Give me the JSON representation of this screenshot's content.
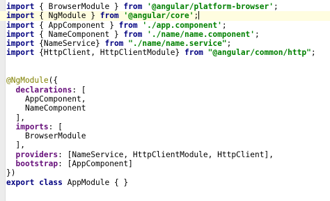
{
  "colors": {
    "keyword": "#000080",
    "string": "#008000",
    "property": "#660e7a",
    "annotation": "#808000",
    "current_line": "#fffde0"
  },
  "lines": [
    {
      "tokens": [
        {
          "t": "import",
          "k": "kw"
        },
        {
          "t": " { BrowserModule } ",
          "k": "plain"
        },
        {
          "t": "from",
          "k": "kw"
        },
        {
          "t": " ",
          "k": "plain"
        },
        {
          "t": "'@angular/platform-browser'",
          "k": "str"
        },
        {
          "t": ";",
          "k": "plain"
        }
      ]
    },
    {
      "current": true,
      "tokens": [
        {
          "t": "import",
          "k": "kw"
        },
        {
          "t": " { NgModule } ",
          "k": "plain"
        },
        {
          "t": "from",
          "k": "kw"
        },
        {
          "t": " ",
          "k": "plain"
        },
        {
          "t": "'@angular/core'",
          "k": "str"
        },
        {
          "t": ";",
          "k": "plain"
        },
        {
          "t": "",
          "k": "caret"
        }
      ]
    },
    {
      "tokens": [
        {
          "t": "import",
          "k": "kw"
        },
        {
          "t": " { AppComponent } ",
          "k": "plain"
        },
        {
          "t": "from",
          "k": "kw"
        },
        {
          "t": " ",
          "k": "plain"
        },
        {
          "t": "'./app.component'",
          "k": "str"
        },
        {
          "t": ";",
          "k": "plain"
        }
      ]
    },
    {
      "tokens": [
        {
          "t": "import",
          "k": "kw"
        },
        {
          "t": " { NameComponent } ",
          "k": "plain"
        },
        {
          "t": "from",
          "k": "kw"
        },
        {
          "t": " ",
          "k": "plain"
        },
        {
          "t": "'./name/name.component'",
          "k": "str"
        },
        {
          "t": ";",
          "k": "plain"
        }
      ]
    },
    {
      "tokens": [
        {
          "t": "import",
          "k": "kw"
        },
        {
          "t": " {NameService} ",
          "k": "plain"
        },
        {
          "t": "from",
          "k": "kw"
        },
        {
          "t": " ",
          "k": "plain"
        },
        {
          "t": "\"./name/name.service\"",
          "k": "str"
        },
        {
          "t": ";",
          "k": "plain"
        }
      ]
    },
    {
      "tokens": [
        {
          "t": "import",
          "k": "kw"
        },
        {
          "t": " {HttpClient, HttpClientModule} ",
          "k": "plain"
        },
        {
          "t": "from",
          "k": "kw"
        },
        {
          "t": " ",
          "k": "plain"
        },
        {
          "t": "\"@angular/common/http\"",
          "k": "str"
        },
        {
          "t": ";",
          "k": "plain"
        }
      ]
    },
    {
      "tokens": []
    },
    {
      "tokens": []
    },
    {
      "tokens": [
        {
          "t": "@NgModule",
          "k": "ann"
        },
        {
          "t": "({",
          "k": "plain"
        }
      ]
    },
    {
      "tokens": [
        {
          "t": "  ",
          "k": "plain"
        },
        {
          "t": "declarations",
          "k": "attr"
        },
        {
          "t": ": [",
          "k": "plain"
        }
      ]
    },
    {
      "tokens": [
        {
          "t": "    AppComponent,",
          "k": "plain"
        }
      ]
    },
    {
      "tokens": [
        {
          "t": "    NameComponent",
          "k": "plain"
        }
      ]
    },
    {
      "tokens": [
        {
          "t": "  ],",
          "k": "plain"
        }
      ]
    },
    {
      "tokens": [
        {
          "t": "  ",
          "k": "plain"
        },
        {
          "t": "imports",
          "k": "attr"
        },
        {
          "t": ": [",
          "k": "plain"
        }
      ]
    },
    {
      "tokens": [
        {
          "t": "    BrowserModule",
          "k": "plain"
        }
      ]
    },
    {
      "tokens": [
        {
          "t": "  ],",
          "k": "plain"
        }
      ]
    },
    {
      "tokens": [
        {
          "t": "  ",
          "k": "plain"
        },
        {
          "t": "providers",
          "k": "attr"
        },
        {
          "t": ": [NameService, HttpClientModule, HttpClient],",
          "k": "plain"
        }
      ]
    },
    {
      "tokens": [
        {
          "t": "  ",
          "k": "plain"
        },
        {
          "t": "bootstrap",
          "k": "attr"
        },
        {
          "t": ": [AppComponent]",
          "k": "plain"
        }
      ]
    },
    {
      "tokens": [
        {
          "t": "})",
          "k": "plain"
        }
      ]
    },
    {
      "tokens": [
        {
          "t": "export",
          "k": "kw"
        },
        {
          "t": " ",
          "k": "plain"
        },
        {
          "t": "class",
          "k": "kw"
        },
        {
          "t": " AppModule { }",
          "k": "plain"
        }
      ]
    }
  ]
}
